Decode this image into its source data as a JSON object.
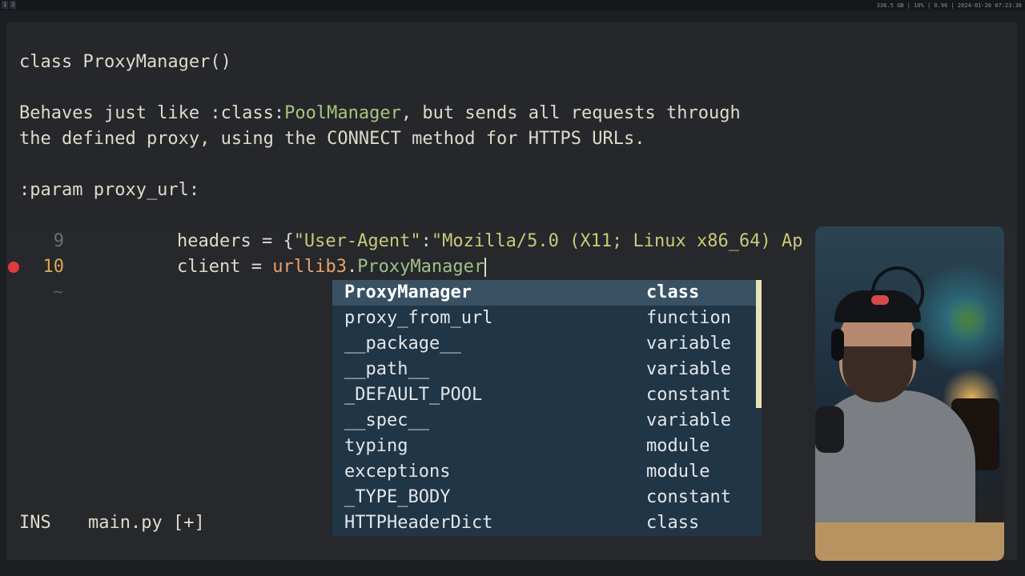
{
  "topbar": {
    "workspaces": [
      "1",
      "2"
    ],
    "status": "336.5 GB | 10% | 0.96 | 2024-01-26 07:23:38"
  },
  "hover_doc": {
    "signature": "class ProxyManager()",
    "desc_line1_pre": "Behaves just like :class:",
    "desc_line1_link": "PoolManager",
    "desc_line1_post": ", but sends all requests through",
    "desc_line2": "the defined proxy, using the CONNECT method for HTTPS URLs.",
    "param_line": ":param proxy_url:"
  },
  "editor": {
    "lines": [
      {
        "number": "9",
        "indent": "    ",
        "var": "headers",
        "op": " = {",
        "key": "\"User-Agent\"",
        "colon": ":",
        "value": "\"Mozilla/5.0 (X11; Linux x86_64) Ap"
      },
      {
        "number": "10",
        "indent": "    ",
        "var": "client",
        "op": " = ",
        "module": "urllib3",
        "dot": ".",
        "attr": "ProxyManager"
      }
    ],
    "empty_marker": "~"
  },
  "completion": {
    "items": [
      {
        "name": "ProxyManager",
        "kind": "class",
        "selected": true
      },
      {
        "name": "proxy_from_url",
        "kind": "function"
      },
      {
        "name": "__package__",
        "kind": "variable"
      },
      {
        "name": "__path__",
        "kind": "variable"
      },
      {
        "name": "_DEFAULT_POOL",
        "kind": "constant"
      },
      {
        "name": "__spec__",
        "kind": "variable"
      },
      {
        "name": "typing",
        "kind": "module"
      },
      {
        "name": "exceptions",
        "kind": "module"
      },
      {
        "name": "_TYPE_BODY",
        "kind": "constant"
      },
      {
        "name": "HTTPHeaderDict",
        "kind": "class"
      }
    ]
  },
  "statusline": {
    "mode": "INS",
    "file": "main.py [+]"
  },
  "colors": {
    "background": "#26282b",
    "completion_bg": "#203546",
    "completion_selected": "#3a5163",
    "line_number_current": "#e0a74f",
    "breakpoint": "#e23a3a"
  }
}
